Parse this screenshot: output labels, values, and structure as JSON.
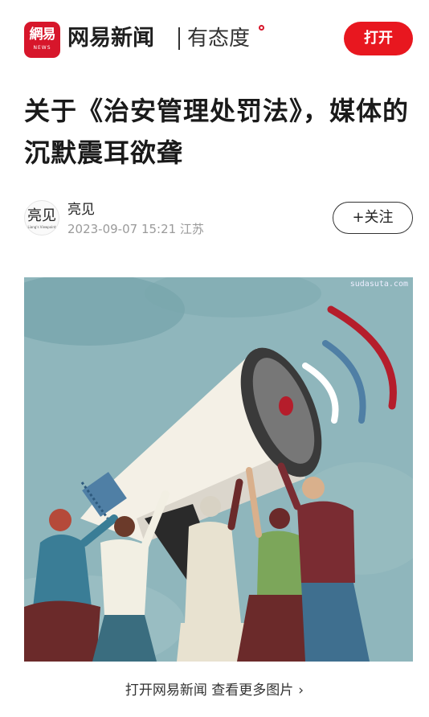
{
  "header": {
    "logo_text": "網易",
    "logo_sub": "NEWS",
    "brand": "网易新闻",
    "slogan": "有态度",
    "open_button": "打开"
  },
  "article": {
    "title": "关于《治安管理处罚法》，媒体的沉默震耳欲聋",
    "author": {
      "avatar_text": "亮见",
      "avatar_sub": "Liang's Viewpoint",
      "name": "亮见",
      "meta": "2023-09-07 15:21 江苏"
    },
    "follow_button": "+关注",
    "image": {
      "watermark": "sudasuta.com"
    }
  },
  "footer": {
    "more_link": "打开网易新闻 查看更多图片",
    "more_arrow_icon": "chevron-right-icon"
  },
  "colors": {
    "accent_red": "#e8171f",
    "logo_red": "#d7162b",
    "image_background": "#8db5bb"
  }
}
